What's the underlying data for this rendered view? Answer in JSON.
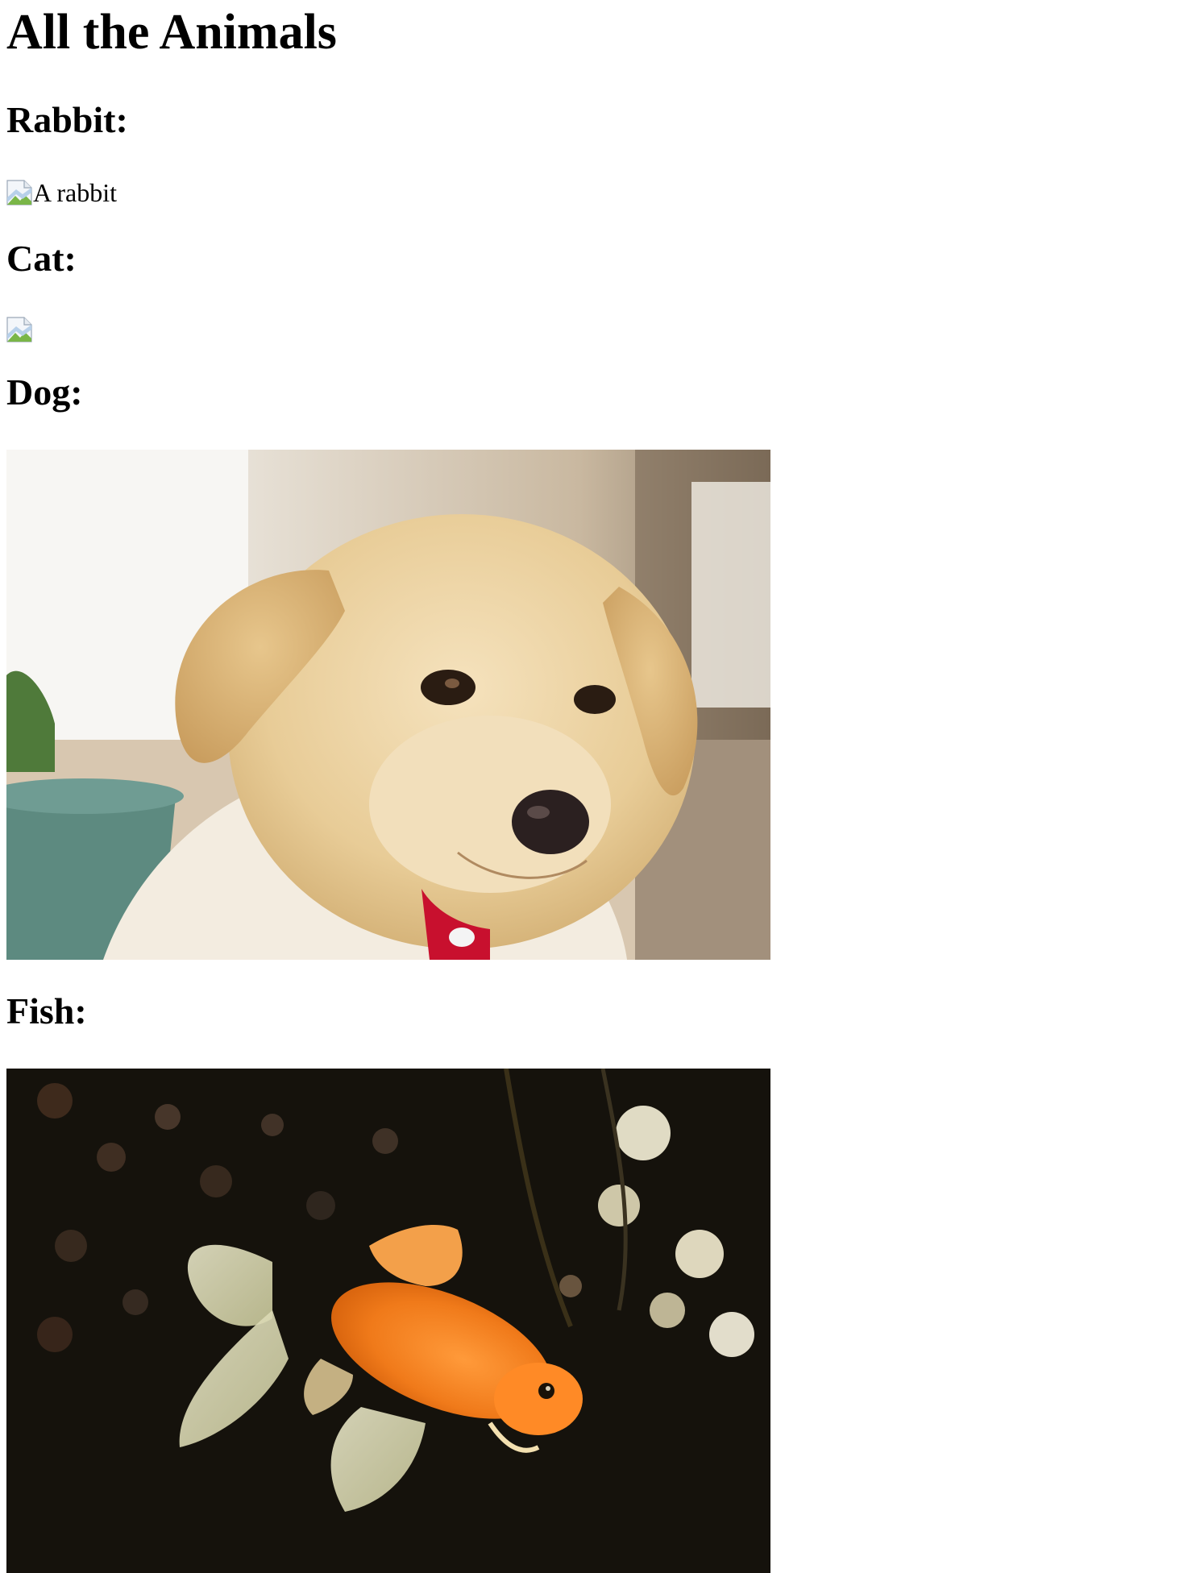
{
  "page": {
    "title": "All the Animals"
  },
  "sections": [
    {
      "heading": "Rabbit:",
      "image": {
        "status": "broken",
        "alt": "A rabbit"
      }
    },
    {
      "heading": "Cat:",
      "image": {
        "status": "broken",
        "alt": ""
      }
    },
    {
      "heading": "Dog:",
      "image": {
        "status": "loaded",
        "subject": "golden retriever puppy with red bow-tie collar"
      }
    },
    {
      "heading": "Fish:",
      "image": {
        "status": "loaded",
        "subject": "orange goldfish on dark background"
      }
    }
  ],
  "icons": {
    "broken_image": "broken-image-icon"
  },
  "colors": {
    "background": "#ffffff",
    "text": "#000000"
  }
}
